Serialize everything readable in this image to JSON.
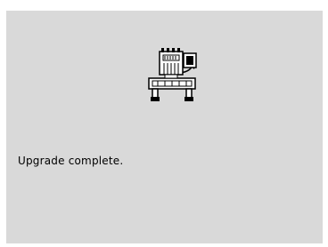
{
  "screen": {
    "status_message": "Upgrade complete."
  },
  "graphic": {
    "icon": "embroidery-machine-upgrade-icon"
  }
}
